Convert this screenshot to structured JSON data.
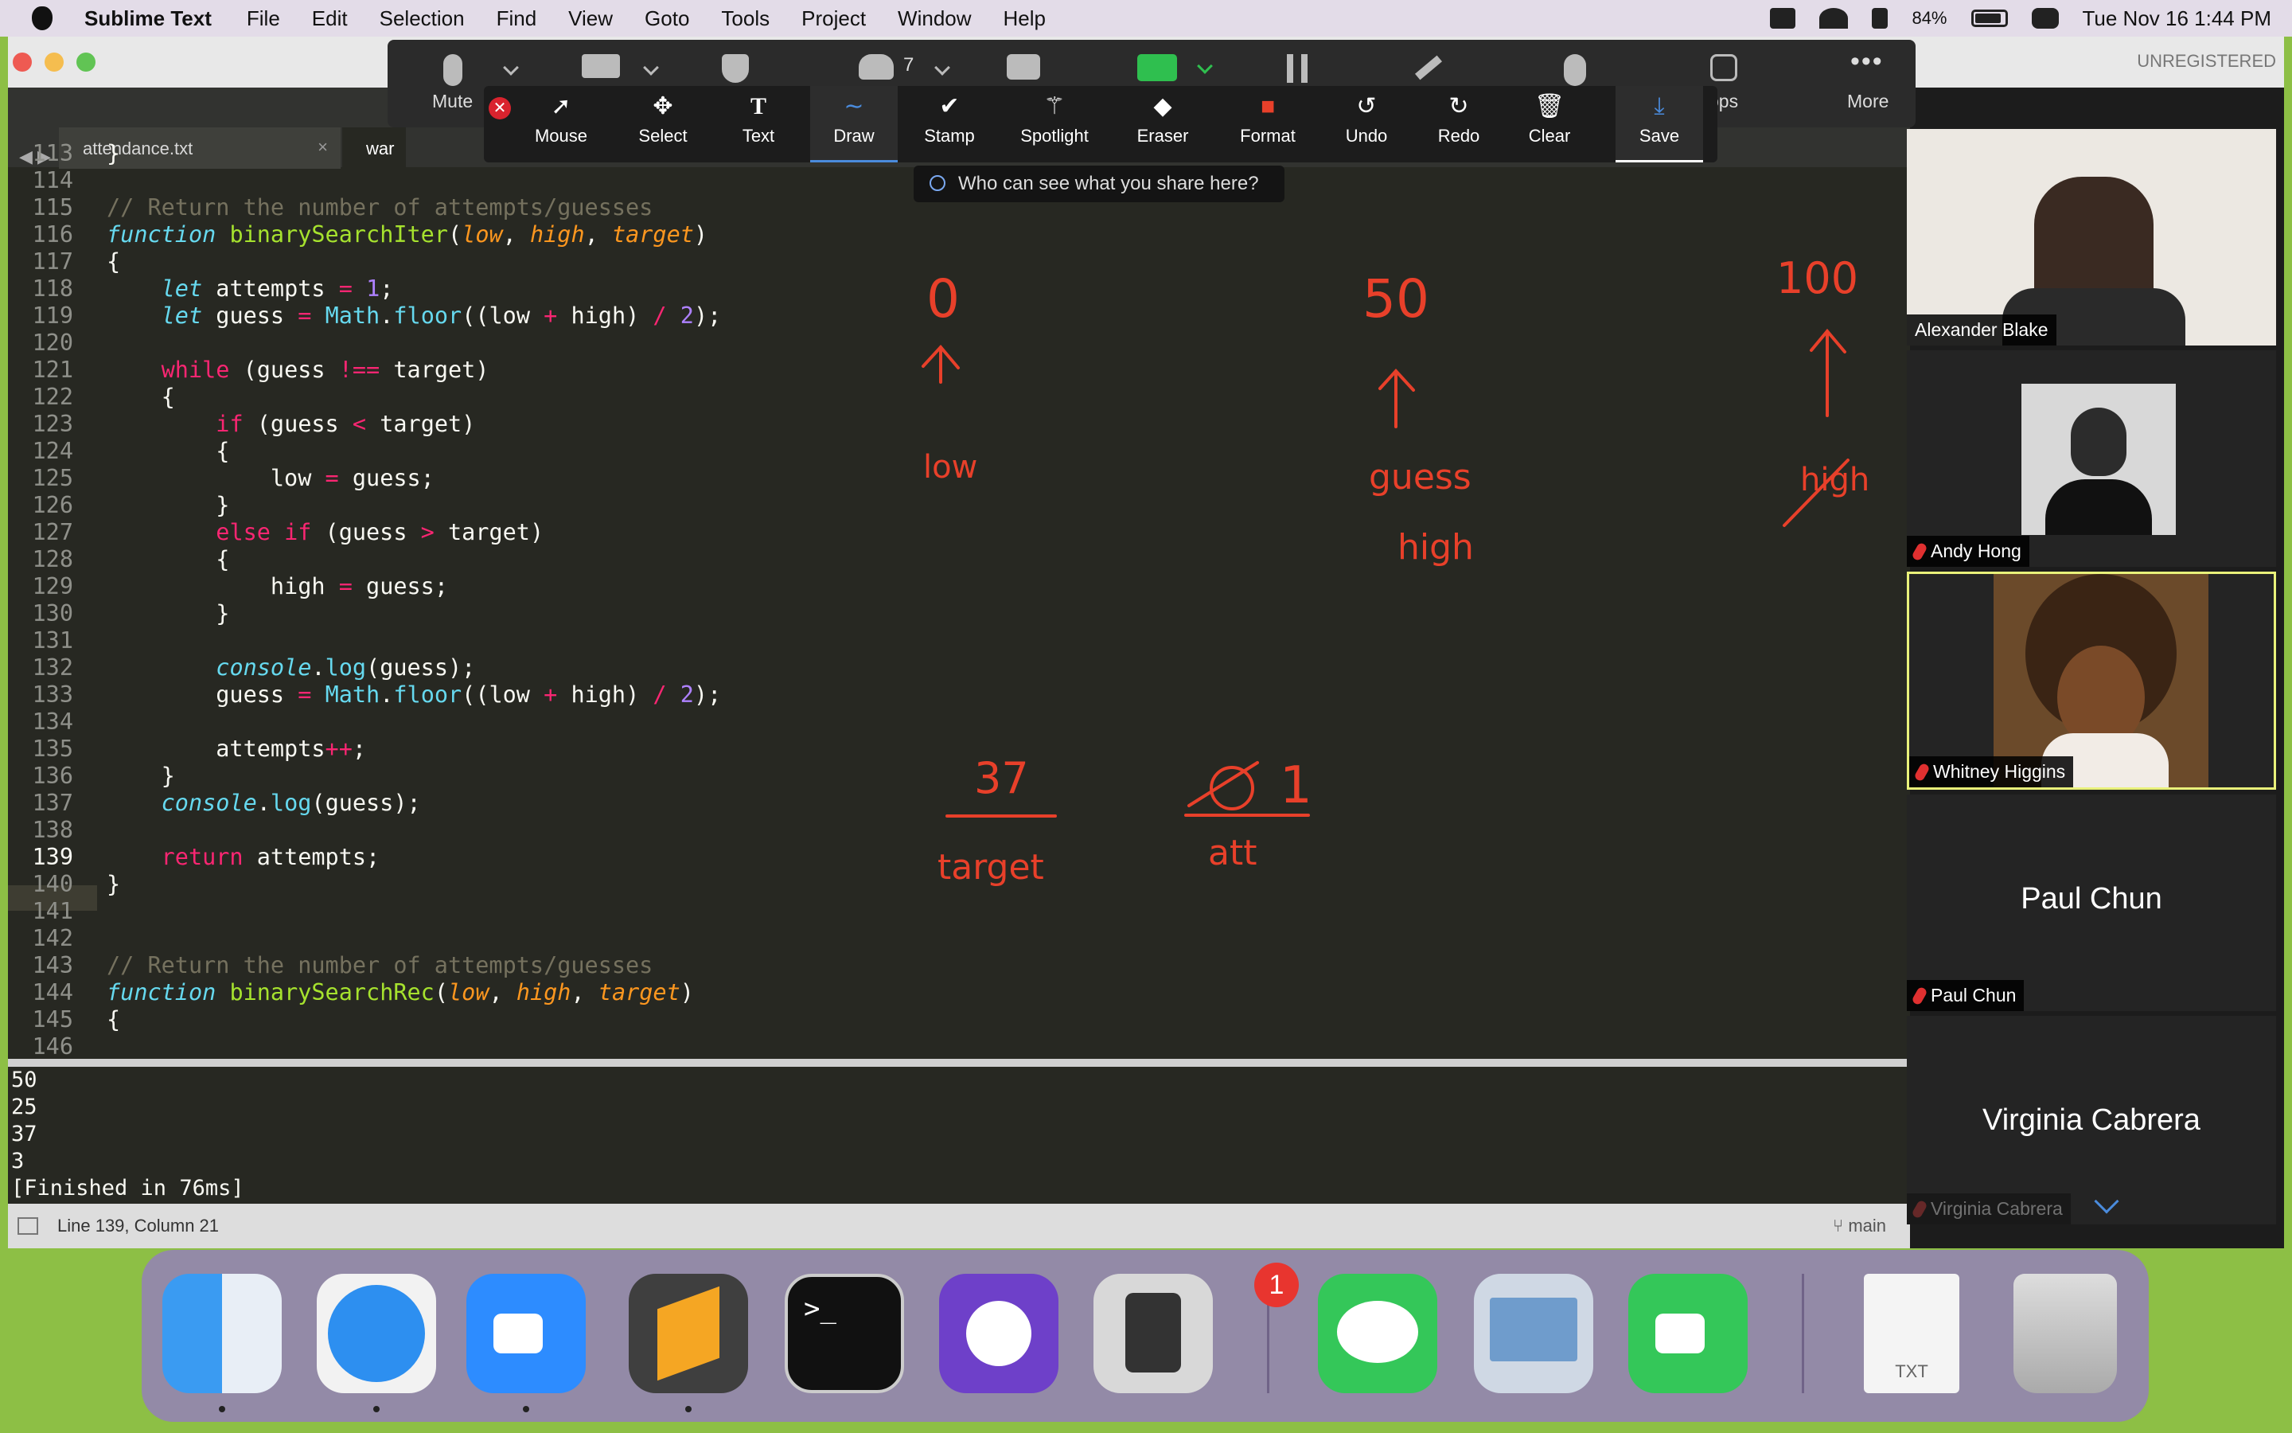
{
  "menubar": {
    "app": "Sublime Text",
    "items": [
      "File",
      "Edit",
      "Selection",
      "Find",
      "View",
      "Goto",
      "Tools",
      "Project",
      "Window",
      "Help"
    ],
    "battery": "84%",
    "clock": "Tue Nov 16  1:44 PM"
  },
  "editor": {
    "unregistered": "UNREGISTERED",
    "tab1": "attendance.txt",
    "tab2": "war",
    "close_symbol": "×",
    "status": "Line 139, Column 21",
    "branch": "main"
  },
  "code": {
    "line_numbers": [
      "113",
      "114",
      "115",
      "116",
      "117",
      "118",
      "119",
      "120",
      "121",
      "122",
      "123",
      "124",
      "125",
      "126",
      "127",
      "128",
      "129",
      "130",
      "131",
      "132",
      "133",
      "134",
      "135",
      "136",
      "137",
      "138",
      "139",
      "140",
      "141",
      "142",
      "143",
      "144",
      "145",
      "146"
    ],
    "comment_return": "// Return the number of attempts/guesses",
    "fn_iter": "binarySearchIter",
    "fn_rec": "binarySearchRec"
  },
  "output": {
    "lines": [
      "50",
      "25",
      "37",
      "3",
      "[Finished in 76ms]"
    ]
  },
  "zoom_toolbar": {
    "mute": "Mute",
    "participants": "7",
    "apps": "ops",
    "more": "More",
    "tools": [
      "Mouse",
      "Select",
      "Text",
      "Draw",
      "Stamp",
      "Spotlight",
      "Eraser",
      "Format",
      "Undo",
      "Redo",
      "Clear",
      "Save"
    ],
    "share_notice": "Who can see what you share here?"
  },
  "participants": [
    {
      "name": "Alexander Blake"
    },
    {
      "name": "Andy Hong"
    },
    {
      "name": "Whitney Higgins"
    },
    {
      "name": "Paul Chun"
    },
    {
      "name": "Virginia Cabrera"
    }
  ],
  "annotations": {
    "n0": "0",
    "n50": "50",
    "n100": "100",
    "low": "low",
    "guess": "guess",
    "high": "high",
    "high2": "high",
    "target_val": "37",
    "target": "target",
    "att_val": "1",
    "att": "att"
  },
  "dock": {
    "messages_badge": "1",
    "txt_label": "TXT"
  },
  "colors": {
    "editor_bg": "#272822",
    "annotation": "#e8402a",
    "desktop": "#8dbf45"
  }
}
